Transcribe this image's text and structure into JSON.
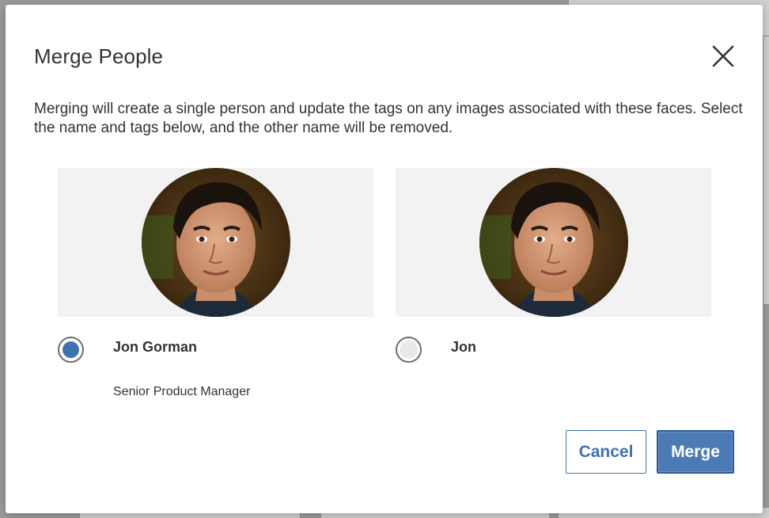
{
  "dialog": {
    "title": "Merge People",
    "description": "Merging will create a single person and update the tags on any images associated with these faces. Select the name and tags below, and the other name will be removed.",
    "close_icon": "close-icon"
  },
  "people": [
    {
      "name": "Jon Gorman",
      "title": "Senior Product Manager",
      "selected": true
    },
    {
      "name": "Jon",
      "title": "",
      "selected": false
    }
  ],
  "actions": {
    "cancel_label": "Cancel",
    "merge_label": "Merge"
  },
  "colors": {
    "accent": "#3f72b1",
    "primary_button": "#4c7ab4",
    "card_background": "#f2f2f2",
    "text": "#333333"
  }
}
